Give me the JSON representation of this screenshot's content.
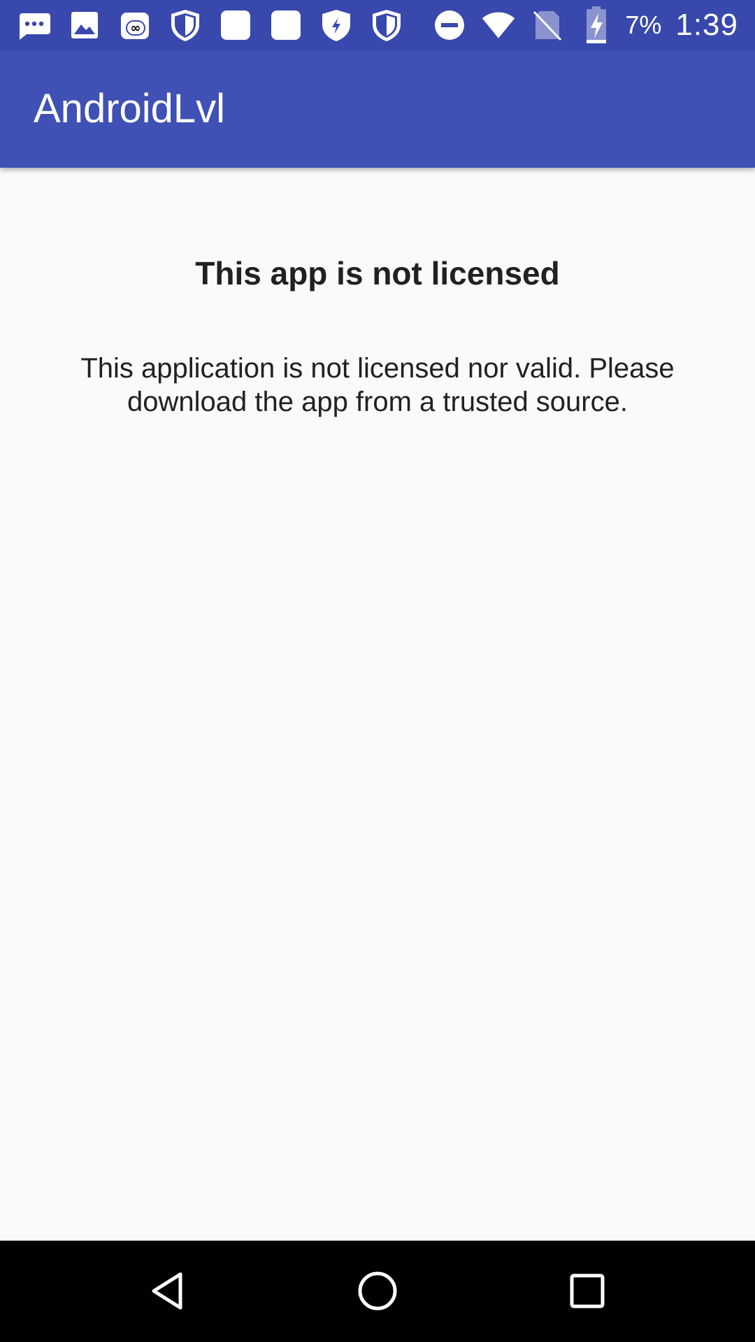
{
  "status_bar": {
    "notification_icons": [
      "sms-icon",
      "gallery-icon",
      "voicemail-icon",
      "shield-icon",
      "app-icon",
      "app-icon",
      "shield-bolt-icon",
      "shield-icon"
    ],
    "system_icons": [
      "do-not-disturb-icon",
      "wifi-icon",
      "no-sim-icon",
      "battery-charging-icon"
    ],
    "battery_percent": "7%",
    "time": "1:39"
  },
  "app_bar": {
    "title": "AndroidLvl"
  },
  "content": {
    "heading": "This app is not licensed",
    "message": "This application is not licensed nor valid. Please download the app from a trusted source."
  },
  "nav_bar": {
    "buttons": [
      "back-icon",
      "home-icon",
      "recents-icon"
    ]
  },
  "colors": {
    "status_bar": "#3848ad",
    "app_bar": "#3f51b5",
    "background": "#fafafa",
    "text": "#212121",
    "nav_bar": "#000000"
  }
}
